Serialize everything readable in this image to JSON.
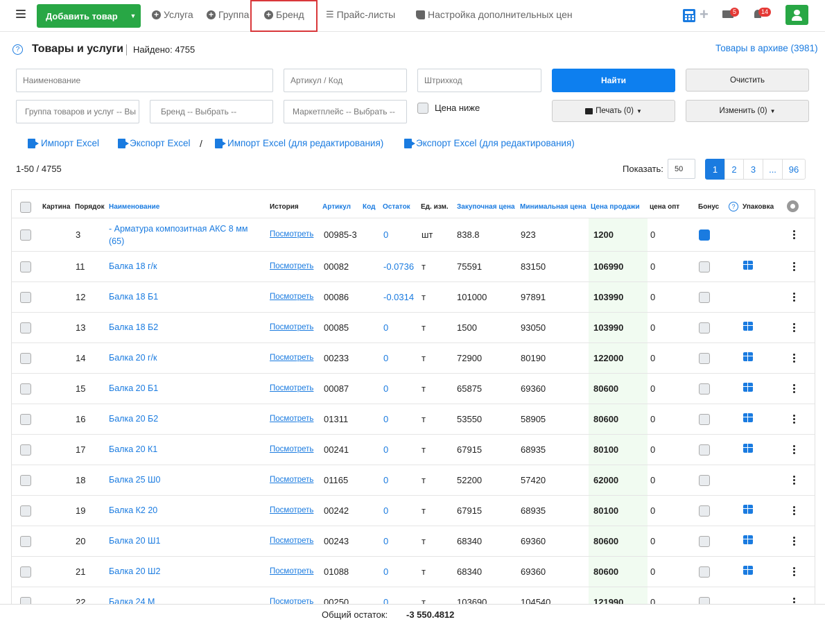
{
  "topbar": {
    "add_label": "Добавить товар",
    "nav": [
      {
        "label": "Услуга",
        "icon": "plus-circle-icon"
      },
      {
        "label": "Группа",
        "icon": "plus-circle-icon"
      },
      {
        "label": "Бренд",
        "icon": "plus-circle-icon"
      },
      {
        "label": "Прайс-листы",
        "icon": "list-icon"
      },
      {
        "label": "Настройка дополнительных цен",
        "icon": "tag-icon"
      }
    ],
    "mail_badge": "5",
    "notif_badge": "14"
  },
  "header": {
    "title": "Товары и услуги",
    "found": "Найдено: 4755",
    "help": "?",
    "archive": "Товары в архиве (3981)"
  },
  "filters": {
    "name_ph": "Наименование",
    "article_ph": "Артикул / Код",
    "barcode_ph": "Штрихкод",
    "group": "Группа товаров и услуг -- Вы",
    "brand": "Бренд -- Выбрать --",
    "marketplace": "Маркетплейс -- Выбрать --",
    "price_lower": "Цена ниже",
    "find": "Найти",
    "clear": "Очистить",
    "print": "Печать (0)",
    "change": "Изменить (0)"
  },
  "actions": {
    "import": "Импорт Excel",
    "export": "Экспорт Excel",
    "sep": "/",
    "import_edit": "Импорт Excel (для редактирования)",
    "export_edit": "Экспорт Excel (для редактирования)"
  },
  "listing": {
    "range": "1-50 / 4755",
    "show_label": "Показать:",
    "per_page": "50",
    "pages": [
      "1",
      "2",
      "3",
      "...",
      "96"
    ]
  },
  "table": {
    "headers": {
      "picture": "Картина",
      "order": "Порядок",
      "name": "Наименование",
      "history": "История",
      "article": "Артикул",
      "code": "Код",
      "stock": "Остаток",
      "unit": "Ед. изм.",
      "purchase": "Закупочная цена",
      "min": "Минимальная цена",
      "sale": "Цена продажи",
      "opt": "цена опт",
      "bonus": "Бонус",
      "pack": "Упаковка"
    },
    "view_label": "Посмотреть",
    "rows": [
      {
        "order": "3",
        "name1": "- Арматура композитная АКС 8 мм",
        "name2": "(65)",
        "article": "00985-3",
        "stock": "0",
        "unit": "шт",
        "purchase": "838.8",
        "min": "923",
        "sale": "1200",
        "opt": "0",
        "bonus": true,
        "pack": false
      },
      {
        "order": "11",
        "name1": "Балка 18 г/к",
        "name2": "",
        "article": "00082",
        "stock": "-0.0736",
        "unit": "т",
        "purchase": "75591",
        "min": "83150",
        "sale": "106990",
        "opt": "0",
        "bonus": false,
        "pack": true
      },
      {
        "order": "12",
        "name1": "Балка 18 Б1",
        "name2": "",
        "article": "00086",
        "stock": "-0.0314",
        "unit": "т",
        "purchase": "101000",
        "min": "97891",
        "sale": "103990",
        "opt": "0",
        "bonus": false,
        "pack": false
      },
      {
        "order": "13",
        "name1": "Балка 18 Б2",
        "name2": "",
        "article": "00085",
        "stock": "0",
        "unit": "т",
        "purchase": "1500",
        "min": "93050",
        "sale": "103990",
        "opt": "0",
        "bonus": false,
        "pack": true
      },
      {
        "order": "14",
        "name1": "Балка 20 г/к",
        "name2": "",
        "article": "00233",
        "stock": "0",
        "unit": "т",
        "purchase": "72900",
        "min": "80190",
        "sale": "122000",
        "opt": "0",
        "bonus": false,
        "pack": true
      },
      {
        "order": "15",
        "name1": "Балка 20 Б1",
        "name2": "",
        "article": "00087",
        "stock": "0",
        "unit": "т",
        "purchase": "65875",
        "min": "69360",
        "sale": "80600",
        "opt": "0",
        "bonus": false,
        "pack": true
      },
      {
        "order": "16",
        "name1": "Балка 20 Б2",
        "name2": "",
        "article": "01311",
        "stock": "0",
        "unit": "т",
        "purchase": "53550",
        "min": "58905",
        "sale": "80600",
        "opt": "0",
        "bonus": false,
        "pack": true
      },
      {
        "order": "17",
        "name1": "Балка 20 К1",
        "name2": "",
        "article": "00241",
        "stock": "0",
        "unit": "т",
        "purchase": "67915",
        "min": "68935",
        "sale": "80100",
        "opt": "0",
        "bonus": false,
        "pack": true
      },
      {
        "order": "18",
        "name1": "Балка 25 Ш0",
        "name2": "",
        "article": "01165",
        "stock": "0",
        "unit": "т",
        "purchase": "52200",
        "min": "57420",
        "sale": "62000",
        "opt": "0",
        "bonus": false,
        "pack": false
      },
      {
        "order": "19",
        "name1": "Балка К2 20",
        "name2": "",
        "article": "00242",
        "stock": "0",
        "unit": "т",
        "purchase": "67915",
        "min": "68935",
        "sale": "80100",
        "opt": "0",
        "bonus": false,
        "pack": true
      },
      {
        "order": "20",
        "name1": "Балка 20 Ш1",
        "name2": "",
        "article": "00243",
        "stock": "0",
        "unit": "т",
        "purchase": "68340",
        "min": "69360",
        "sale": "80600",
        "opt": "0",
        "bonus": false,
        "pack": true
      },
      {
        "order": "21",
        "name1": "Балка 20 Ш2",
        "name2": "",
        "article": "01088",
        "stock": "0",
        "unit": "т",
        "purchase": "68340",
        "min": "69360",
        "sale": "80600",
        "opt": "0",
        "bonus": false,
        "pack": true
      },
      {
        "order": "22",
        "name1": "Балка 24 М",
        "name2": "",
        "article": "00250",
        "stock": "0",
        "unit": "т",
        "purchase": "103690",
        "min": "104540",
        "sale": "121990",
        "opt": "0",
        "bonus": false,
        "pack": false
      }
    ]
  },
  "footer": {
    "label": "Общий остаток:",
    "value": "-3 550.4812"
  },
  "colors": {
    "primary": "#1a7be0",
    "success": "#28a745",
    "danger": "#e53935",
    "highlight": "#d9373a"
  }
}
